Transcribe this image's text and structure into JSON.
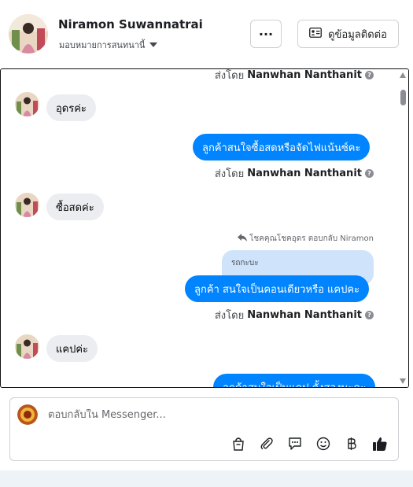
{
  "header": {
    "name": "Niramon Suwannatrai",
    "assign_label": "มอบหมายการสนทนานี้",
    "more_label": "···",
    "contact_label": "ดูข้อมูลติดต่อ"
  },
  "chat": {
    "sent_by_prefix": "ส่งโดย",
    "agent_name": "Nanwhan Nanthanit",
    "messages": [
      {
        "from": "customer",
        "text": "อุดรค่ะ"
      },
      {
        "from": "page",
        "text": "ลูกค้าสนใจซื้อสดหรือจัดไฟแน้นซ์คะ"
      },
      {
        "from": "customer",
        "text": "ซื้อสดค่ะ"
      },
      {
        "from": "page",
        "text": "ลูกค้า  สนใจเป็นคอนเดียวหรือ แคปคะ"
      },
      {
        "from": "customer",
        "text": "แคปค่ะ"
      },
      {
        "from": "page",
        "text": "ลูกค้าสนใจเป็นแคป ตั้งสองนะคะ"
      }
    ],
    "reply_info": "โชคคุณโชคอุดร ตอบกลับ Niramon",
    "reply_quote": "รถกะบะ"
  },
  "composer": {
    "placeholder": "ตอบกลับใน Messenger...",
    "tools": [
      "shopping-bag-icon",
      "paperclip-icon",
      "saved-reply-icon",
      "emoji-icon",
      "baht-icon",
      "like-icon"
    ],
    "like_color": "#1c1e21"
  },
  "colors": {
    "outgoing_bubble": "#0084ff",
    "incoming_bubble": "#ebedf0",
    "reply_quote_bg": "#cfe3fb"
  }
}
